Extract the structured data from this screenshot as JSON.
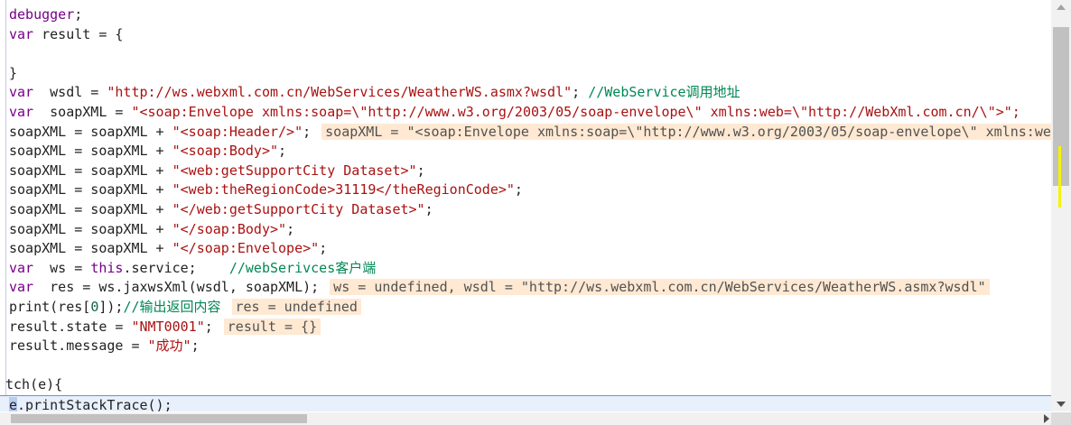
{
  "code": {
    "line01": {
      "id": "debugger",
      "rest": ";"
    },
    "line02": {
      "kw": "var",
      "rest": " result = {"
    },
    "line03": {
      "text": ""
    },
    "line04": {
      "text": "}"
    },
    "line05": {
      "kw": "var",
      "pre": "  wsdl = ",
      "str": "\"http://ws.webxml.com.cn/WebServices/WeatherWS.asmx?wsdl\"",
      "post": "; ",
      "comment": "//WebService调用地址"
    },
    "line06": {
      "kw": "var",
      "pre": "  soapXML = ",
      "str": "\"<soap:Envelope xmlns:soap=\\\"http://www.w3.org/2003/05/soap-envelope\\\" xmlns:web=\\\"http://WebXml.com.cn/\\\">\";"
    },
    "line07": {
      "pre": "soapXML = soapXML + ",
      "str": "\"<soap:Header/>\"",
      "post": ";",
      "inline": "soapXML = \"<soap:Envelope xmlns:soap=\\\"http://www.w3.org/2003/05/soap-envelope\\\" xmlns:web=\\\"http://WebXml.com.cn/\\\"><soap:Header/>"
    },
    "line08": {
      "pre": "soapXML = soapXML + ",
      "str": "\"<soap:Body>\"",
      "post": ";"
    },
    "line09": {
      "pre": "soapXML = soapXML + ",
      "str": "\"<web:getSupportCity Dataset>\"",
      "post": ";"
    },
    "line10": {
      "pre": "soapXML = soapXML + ",
      "str": "\"<web:theRegionCode>31119</theRegionCode>\"",
      "post": ";"
    },
    "line11": {
      "pre": "soapXML = soapXML + ",
      "str": "\"</web:getSupportCity Dataset>\"",
      "post": ";"
    },
    "line12": {
      "pre": "soapXML = soapXML + ",
      "str": "\"</soap:Body>\"",
      "post": ";"
    },
    "line13": {
      "pre": "soapXML = soapXML + ",
      "str": "\"</soap:Envelope>\"",
      "post": ";"
    },
    "line14": {
      "kw": "var",
      "pre": "  ws = ",
      "this": "this",
      "post": ".service;    ",
      "comment": "//webSerivces客户端"
    },
    "line15": {
      "kw": "var",
      "pre": "  res = ws.jaxwsXml(wsdl, soapXML);",
      "inline": "ws = undefined, wsdl = \"http://ws.webxml.com.cn/WebServices/WeatherWS.asmx?wsdl\""
    },
    "line16": {
      "pre": "print(res[",
      "num": "0",
      "post": "]);",
      "comment": "//输出返回内容",
      "inline": "res = undefined"
    },
    "line17": {
      "pre": "result.state = ",
      "str": "\"NMT0001\"",
      "post": ";",
      "inline": "result = {}"
    },
    "line18": {
      "pre": "result.message = ",
      "str": "\"成功\"",
      "post": ";"
    },
    "line19": {
      "text": ""
    },
    "line20": {
      "text": "tch(e){"
    },
    "line21": {
      "cursor": "e",
      "rest": ".printStackTrace();"
    }
  },
  "colors": {
    "keyword": "#770088",
    "string": "#aa1111",
    "comment": "#008855",
    "inline_value_bg": "#ffe6cc",
    "current_line_bg": "#e8f0fc",
    "scroll_marker": "#f4f400"
  },
  "icons": {
    "scroll_up": "triangle-up-icon",
    "scroll_down": "triangle-down-icon",
    "scroll_right": "triangle-right-icon"
  }
}
